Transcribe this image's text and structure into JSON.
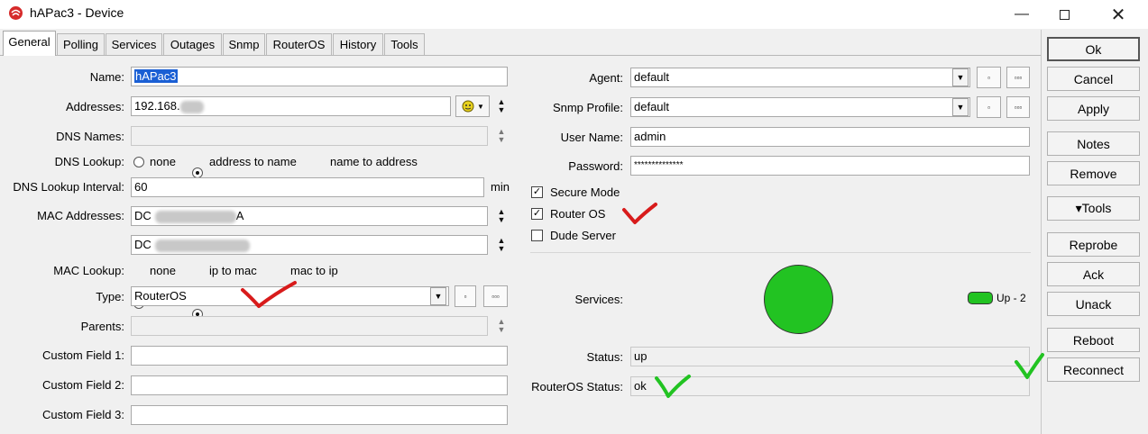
{
  "window": {
    "title": "hAPac3 - Device",
    "controls": [
      "minimize-icon",
      "maximize-icon",
      "close-icon"
    ]
  },
  "tabs": [
    {
      "label": "General",
      "active": true
    },
    {
      "label": "Polling"
    },
    {
      "label": "Services"
    },
    {
      "label": "Outages"
    },
    {
      "label": "Snmp"
    },
    {
      "label": "RouterOS"
    },
    {
      "label": "History"
    },
    {
      "label": "Tools"
    }
  ],
  "general": {
    "name": {
      "label": "Name:",
      "value": "hAPac3"
    },
    "addresses": {
      "label": "Addresses:",
      "value_visible": "192.168."
    },
    "dns_names": {
      "label": "DNS Names:",
      "value": ""
    },
    "dns_lookup": {
      "label": "DNS Lookup:",
      "options": [
        "none",
        "address to name",
        "name to address"
      ],
      "selected": "address to name"
    },
    "dns_lookup_interval": {
      "label": "DNS Lookup Interval:",
      "value": "60",
      "unit": "min"
    },
    "mac_addresses": {
      "label": "MAC Addresses:",
      "values_visible": [
        "DC",
        "DC"
      ],
      "suffix_visible": "A"
    },
    "mac_lookup": {
      "label": "MAC Lookup:",
      "options": [
        "none",
        "ip to mac",
        "mac to ip"
      ],
      "selected": "ip to mac"
    },
    "type": {
      "label": "Type:",
      "value": "RouterOS"
    },
    "parents": {
      "label": "Parents:",
      "value": ""
    },
    "custom_fields": [
      {
        "label": "Custom Field 1:",
        "value": ""
      },
      {
        "label": "Custom Field 2:",
        "value": ""
      },
      {
        "label": "Custom Field 3:",
        "value": ""
      }
    ],
    "agent": {
      "label": "Agent:",
      "value": "default"
    },
    "snmp_profile": {
      "label": "Snmp Profile:",
      "value": "default"
    },
    "user_name": {
      "label": "User Name:",
      "value": "admin"
    },
    "password": {
      "label": "Password:",
      "value": "**************"
    },
    "checkboxes": [
      {
        "label": "Secure Mode",
        "checked": true
      },
      {
        "label": "Router OS",
        "checked": true
      },
      {
        "label": "Dude Server",
        "checked": false
      }
    ],
    "services": {
      "label": "Services:",
      "legend": "Up - 2",
      "color": "#22c322"
    },
    "status": {
      "label": "Status:",
      "value": "up"
    },
    "routeros_status": {
      "label": "RouterOS Status:",
      "value": "ok"
    }
  },
  "combo": {
    "arrow": "▼",
    "small_btn": "▫",
    "more_btn": "▫▫▫"
  },
  "side_buttons": [
    "Ok",
    "Cancel",
    "Apply",
    "Notes",
    "Remove",
    "▾Tools",
    "Reprobe",
    "Ack",
    "Unack",
    "Reboot",
    "Reconnect"
  ],
  "annotations": {
    "red": "#d81b1b",
    "green": "#22c322"
  }
}
